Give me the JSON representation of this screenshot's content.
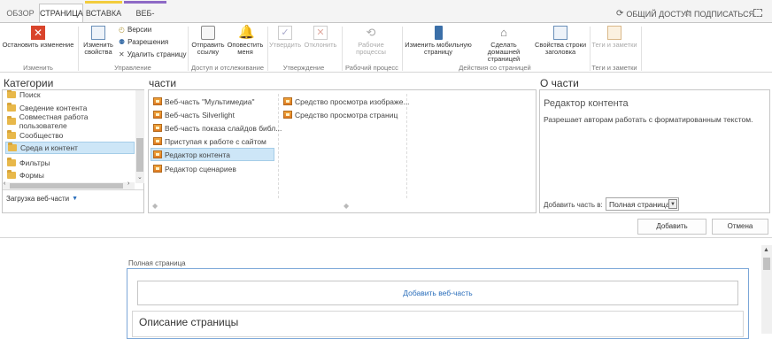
{
  "tabs": [
    {
      "label": "ОБЗОР"
    },
    {
      "label": "СТРАНИЦА"
    },
    {
      "label": "ВСТАВКА"
    },
    {
      "label": "ВЕБ-ЧАСТЬ"
    }
  ],
  "topright": {
    "share": "ОБЩИЙ ДОСТУП",
    "follow": "ПОДПИСАТЬСЯ"
  },
  "ribbon": {
    "stop_edit": "Остановить изменение",
    "edit_group": "Изменить",
    "edit_props": "Изменить свойства",
    "versions": "Версии",
    "permissions": "Разрешения",
    "delete_page": "Удалить страницу",
    "manage_group": "Управление",
    "send_link": "Отправить ссылку",
    "alert_me": "Оповестить меня",
    "share_group": "Доступ и отслеживание",
    "approve": "Утвердить",
    "reject": "Отклонить",
    "approval_group": "Утверждение",
    "workflows": "Рабочие процессы",
    "workflow_group": "Рабочий процесс",
    "mobile_page": "Изменить мобильную страницу",
    "make_home": "Сделать домашней страницей",
    "title_bar": "Свойства строки заголовка",
    "page_actions_group": "Действия со страницей",
    "tags": "Теги и заметки",
    "tags_group": "Теги и заметки"
  },
  "adder": {
    "categories_title": "Категории",
    "parts_title": "части",
    "about_title": "О части",
    "categories": [
      "Поиск",
      "Сведение контента",
      "Совместная работа пользователе",
      "Сообщество",
      "Среда и контент",
      "Фильтры",
      "Формы"
    ],
    "selected_category": "Среда и контент",
    "upload": "Загрузка веб-части",
    "parts_col1": [
      "Веб-часть \"Мультимедиа\"",
      "Веб-часть Silverlight",
      "Веб-часть показа слайдов библ...",
      "Приступая к работе с сайтом",
      "Редактор контента",
      "Редактор сценариев"
    ],
    "parts_col2": [
      "Средство просмотра изображе...",
      "Средство просмотра страниц"
    ],
    "selected_part": "Редактор контента",
    "about_name": "Редактор контента",
    "about_desc": "Разрешает авторам работать с форматированным текстом.",
    "add_to_label": "Добавить часть в:",
    "add_to_value": "Полная страница",
    "add_button": "Добавить",
    "cancel_button": "Отмена"
  },
  "page": {
    "zone_label": "Полная страница",
    "add_webpart_link": "Добавить веб-часть",
    "description_heading": "Описание страницы"
  }
}
